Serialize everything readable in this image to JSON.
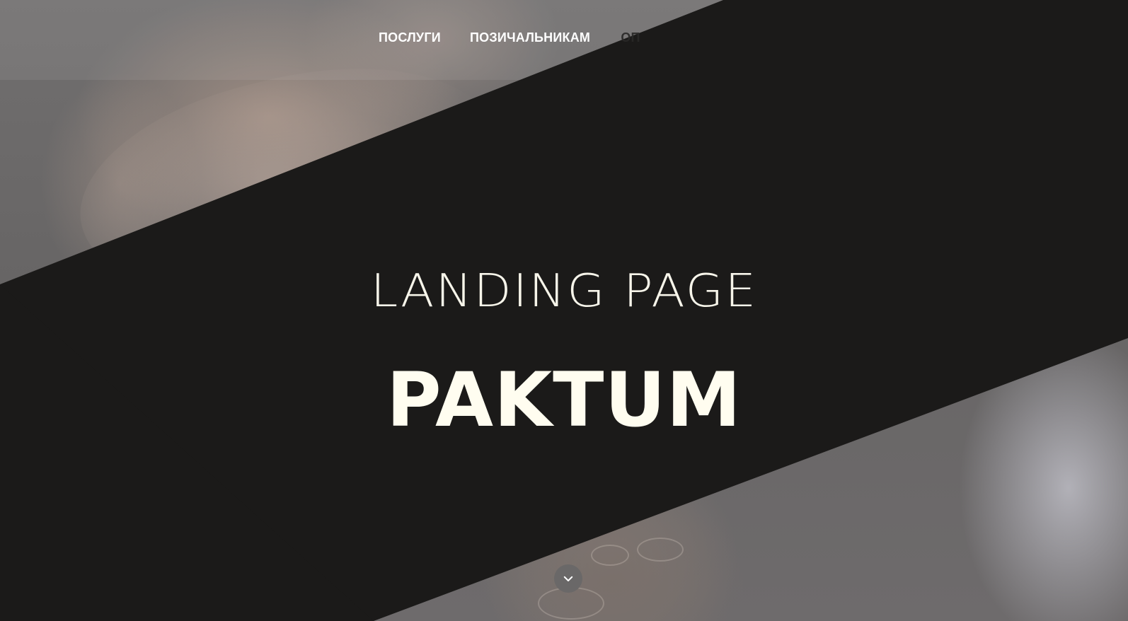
{
  "navigation": {
    "items": [
      {
        "label": "ПОСЛУГИ"
      },
      {
        "label": "ПОЗИЧАЛЬНИКАМ"
      },
      {
        "label": "ОП"
      }
    ]
  },
  "hero": {
    "headline": "LANDING PAGE",
    "brand_name": "PAKTUM",
    "scroll_icon": "chevron-down-icon"
  },
  "colors": {
    "dark_band": "#1b1a19",
    "hero_text": "#fffdf0",
    "nav_text": "#ffffff",
    "photo_overlay": "#6b6868"
  }
}
